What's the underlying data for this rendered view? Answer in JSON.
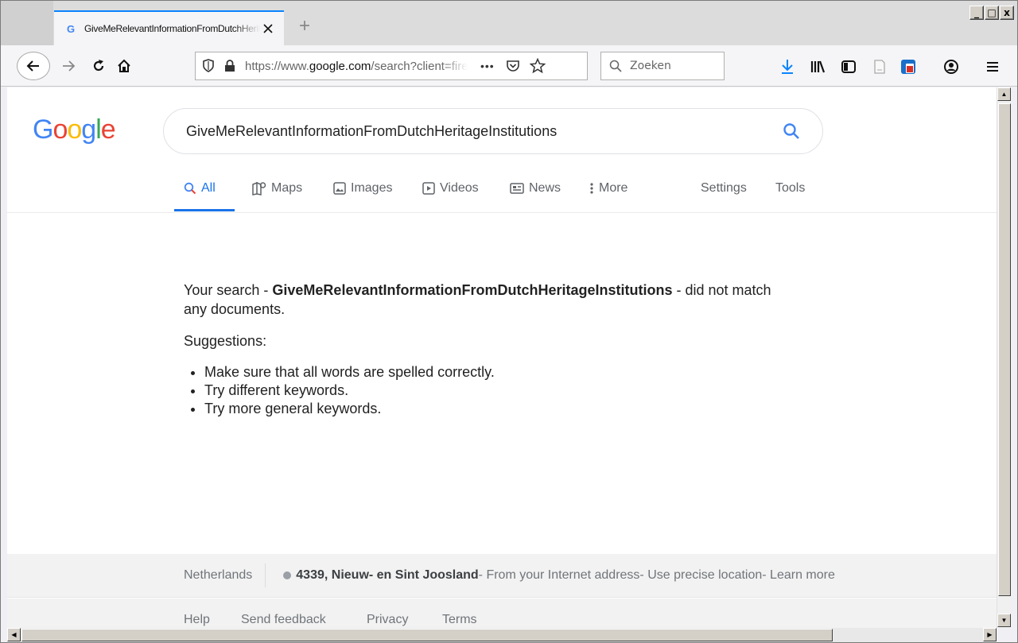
{
  "browser": {
    "tab_title": "GiveMeRelevantInformationFromDutchHeritageInstitutions",
    "new_tab_glyph": "+",
    "window_buttons": [
      "_",
      "□",
      "x"
    ],
    "url_prefix": "https://www.",
    "url_domain": "google.com",
    "url_path": "/search?client=firefox-b-d&q=GiveMeRelevantInformationFromDutchHeritageInstitutions",
    "url_actions_glyph": "•••",
    "search_placeholder": "Zoeken",
    "icons": [
      "back-arrow-icon",
      "forward-arrow-icon",
      "reload-icon",
      "home-icon",
      "shield-icon",
      "lock-icon",
      "pocket-icon",
      "star-icon",
      "search-icon",
      "download-icon",
      "library-icon",
      "sidebar-icon",
      "reader-icon",
      "extension-icon",
      "account-icon",
      "menu-icon"
    ]
  },
  "google": {
    "logo": [
      "G",
      "o",
      "o",
      "g",
      "l",
      "e"
    ],
    "logo_colors": [
      "#4285f4",
      "#ea4335",
      "#fbbc05",
      "#4285f4",
      "#34a853",
      "#ea4335"
    ],
    "query": "GiveMeRelevantInformationFromDutchHeritageInstitutions",
    "tabs": {
      "all": "All",
      "maps": "Maps",
      "images": "Images",
      "videos": "Videos",
      "news": "News",
      "more": "More",
      "settings": "Settings",
      "tools": "Tools"
    },
    "message": {
      "before": "Your search - ",
      "query": "GiveMeRelevantInformationFromDutchHeritageInstitutions",
      "after": " - did not match any documents."
    },
    "suggestions_label": "Suggestions:",
    "suggestions": [
      "Make sure that all words are spelled correctly.",
      "Try different keywords.",
      "Try more general keywords."
    ],
    "footer": {
      "country": "Netherlands",
      "place": "4339, Nieuw- en Sint Joosland",
      "from_address": " - From your Internet address",
      "use_precise": " - Use precise location",
      "learn_more": " - Learn more",
      "links": [
        "Help",
        "Send feedback",
        "Privacy",
        "Terms"
      ]
    }
  },
  "colors": {
    "accent": "#1a73e8",
    "tab_highlight": "#0a84ff"
  }
}
